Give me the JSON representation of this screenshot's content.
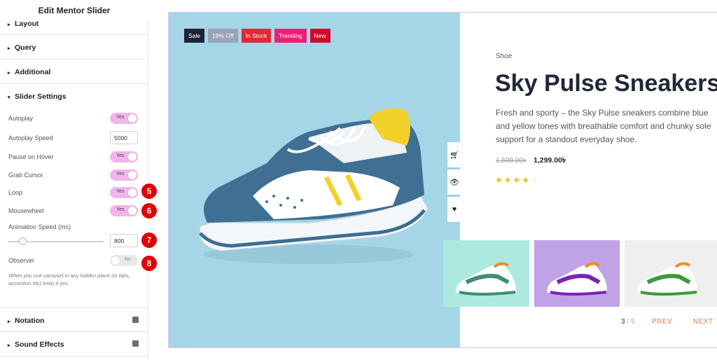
{
  "panel": {
    "title": "Edit Mentor Slider",
    "sections_top": [
      "Layout",
      "Query",
      "Additional",
      "Slider Settings"
    ],
    "controls": {
      "autoplay": {
        "label": "Autoplay",
        "value": "Yes"
      },
      "autoplay_speed": {
        "label": "Autoplay Speed",
        "value": "5000"
      },
      "pause_on_hover": {
        "label": "Pause on Hover",
        "value": "Yes"
      },
      "grab_cursor": {
        "label": "Grab Cursor",
        "value": "Yes"
      },
      "loop": {
        "label": "Loop",
        "value": "Yes",
        "badge": "5"
      },
      "mousewheel": {
        "label": "Mousewheel",
        "value": "Yes",
        "badge": "6"
      },
      "animation_speed": {
        "label": "Animation Speed (ms)",
        "value": "800",
        "badge": "7",
        "slider_fraction": 0.15
      },
      "observer": {
        "label": "Observer",
        "value": "No",
        "badge": "8"
      }
    },
    "observer_hint": "When you use carousel in any hidden place (in tabs, accordion etc) keep it yes.",
    "sections_bottom": [
      "Notation",
      "Sound Effects"
    ]
  },
  "product": {
    "tags": [
      {
        "label": "Sale",
        "color": "#1f2235"
      },
      {
        "label": "19% Off",
        "color": "#9aa3b7"
      },
      {
        "label": "In Stock",
        "color": "#e22839"
      },
      {
        "label": "Trending",
        "color": "#ee1f77"
      },
      {
        "label": "New",
        "color": "#d10a2c"
      }
    ],
    "category": "Shoe",
    "title": "Sky Pulse Sneakers",
    "description": "Fresh and sporty – the Sky Pulse sneakers combine blue and yellow tones with breathable comfort and chunky sole support for a standout everyday shoe.",
    "price_old": "1,599.00৳",
    "price_new": "1,299.00৳",
    "rating": 4,
    "rating_max": 5,
    "actions": [
      "cart-icon",
      "eye-icon",
      "heart-icon"
    ],
    "thumbnails": [
      {
        "bg": "#aee9df",
        "accent": "#3e8c7a"
      },
      {
        "bg": "#bfa3e6",
        "accent": "#7a22b8"
      },
      {
        "bg": "#efefef",
        "accent": "#3c9a3a"
      }
    ],
    "pager": {
      "current": "3",
      "separator": "/",
      "total": "5"
    },
    "prev_label": "PREV",
    "next_label": "NEXT"
  },
  "colors": {
    "accent_pink": "#f1b4ec",
    "badge_red": "#e00000",
    "hero_bg": "#a4d6e8",
    "link_orange": "#e07a3e"
  }
}
